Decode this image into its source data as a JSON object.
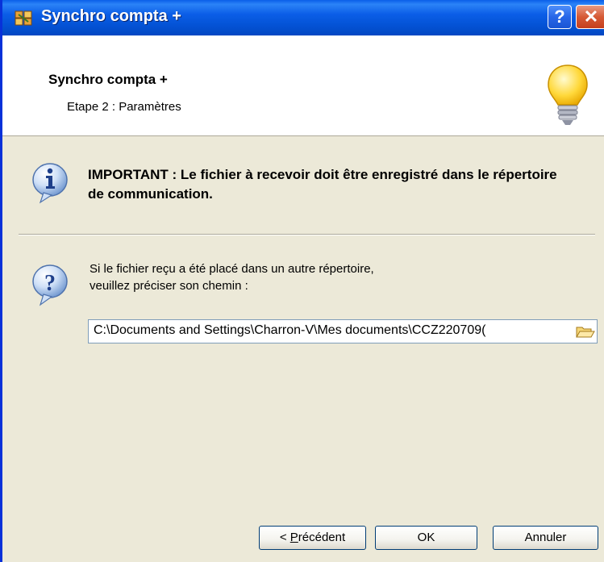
{
  "window": {
    "title": "Synchro compta +",
    "help_label": "?",
    "close_label": "✕"
  },
  "header": {
    "title": "Synchro compta +",
    "step": "Etape 2 : Paramètres"
  },
  "important": {
    "text": "IMPORTANT : Le fichier à recevoir doit être enregistré dans le répertoire de communication."
  },
  "path_section": {
    "hint_line1": "Si le fichier reçu a été placé dans un autre répertoire,",
    "hint_line2": "veuillez préciser son chemin :",
    "path_value": "C:\\Documents and Settings\\Charron-V\\Mes documents\\CCZ220709("
  },
  "buttons": {
    "prev_prefix": "< ",
    "prev_underlined": "P",
    "prev_rest": "récédent",
    "ok": "OK",
    "cancel": "Annuler"
  },
  "icons": {
    "app": "app-icon",
    "bulb": "lightbulb-icon",
    "info": "info-icon",
    "question": "question-icon",
    "browse": "folder-open-icon"
  },
  "colors": {
    "titlebar": "#0453d6",
    "dialog_bg": "#ece9d8",
    "close": "#d65a35"
  }
}
